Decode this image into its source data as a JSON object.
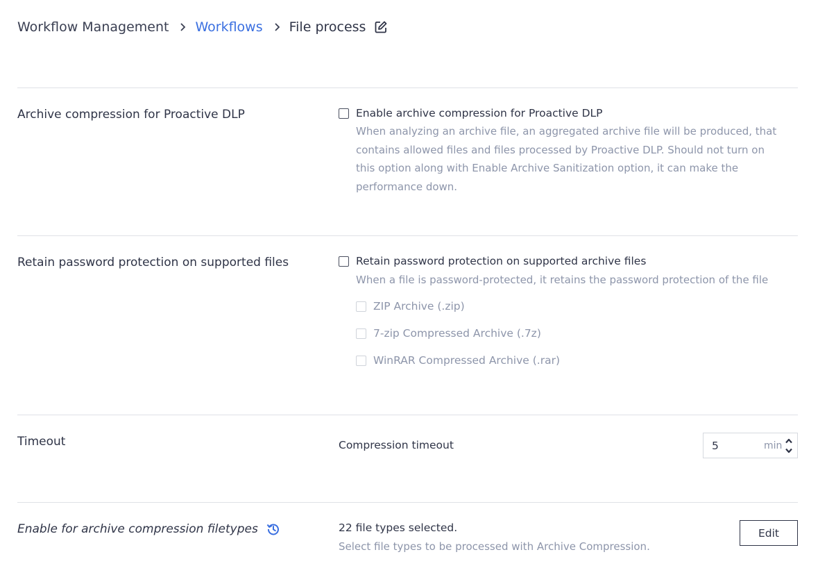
{
  "breadcrumb": {
    "root": "Workflow Management",
    "link": "Workflows",
    "current": "File process"
  },
  "sections": {
    "archive_compression": {
      "title": "Archive compression for Proactive DLP",
      "checkbox_label": "Enable archive compression for Proactive DLP",
      "checked": false,
      "description": "When analyzing an archive file, an aggregated archive file will be produced, that contains allowed files and files processed by Proactive DLP. Should not turn on this option along with Enable Archive Sanitization option, it can make the performance down."
    },
    "retain_password": {
      "title": "Retain password protection on supported files",
      "checkbox_label": "Retain password protection on supported archive files",
      "checked": false,
      "description": "When a file is password-protected, it retains the password protection of the file",
      "options": [
        {
          "label": "ZIP Archive (.zip)",
          "checked": false,
          "disabled": true
        },
        {
          "label": "7-zip Compressed Archive (.7z)",
          "checked": false,
          "disabled": true
        },
        {
          "label": "WinRAR Compressed Archive (.rar)",
          "checked": false,
          "disabled": true
        }
      ]
    },
    "timeout": {
      "title": "Timeout",
      "field_label": "Compression timeout",
      "value": "5",
      "unit": "min"
    },
    "filetypes": {
      "title": "Enable for archive compression filetypes",
      "summary": "22 file types selected.",
      "description": "Select file types to be processed with Archive Compression.",
      "edit_label": "Edit"
    }
  },
  "colors": {
    "link": "#3a6fe0",
    "text": "#2f3447",
    "muted": "#8d95aa",
    "divider": "#dfe1e6"
  }
}
